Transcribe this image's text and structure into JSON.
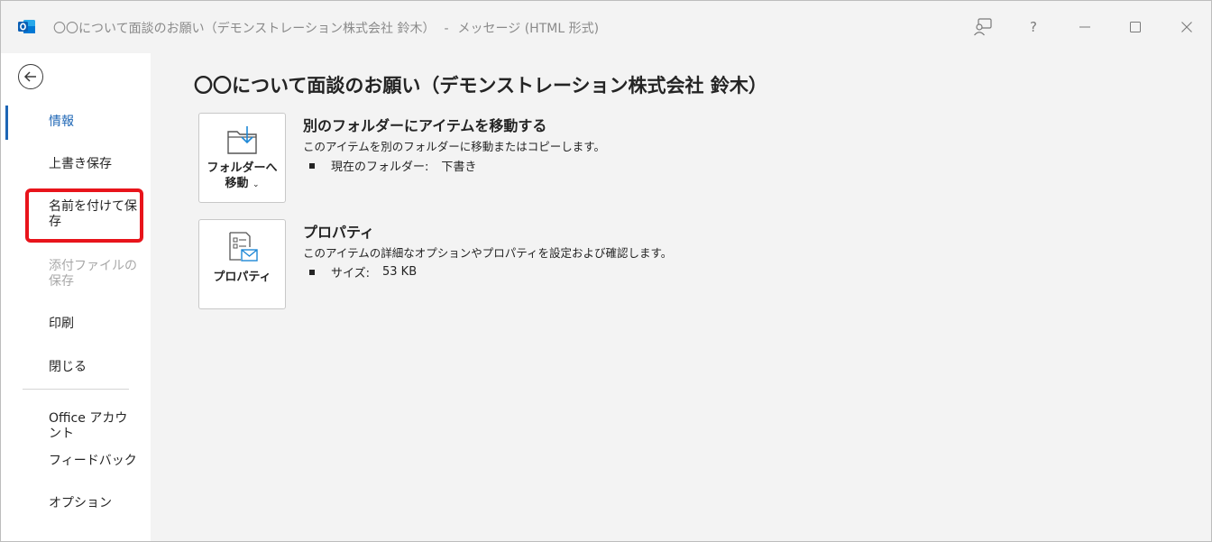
{
  "titlebar": {
    "subject": "〇〇について面談のお願い（デモンストレーション株式会社 鈴木）",
    "separator": "-",
    "window_type": "メッセージ (HTML 形式)",
    "app_icon": "outlook-icon",
    "buttons": [
      "coaching-icon",
      "help-icon",
      "minimize-icon",
      "maximize-icon",
      "close-icon"
    ],
    "help_label": "?"
  },
  "sidebar": {
    "items": [
      {
        "label": "情報",
        "state": "active"
      },
      {
        "label": "上書き保存",
        "state": "normal"
      },
      {
        "label": "名前を付けて保存",
        "state": "highlighted"
      },
      {
        "label": "添付ファイルの保存",
        "state": "disabled"
      },
      {
        "label": "印刷",
        "state": "normal"
      },
      {
        "label": "閉じる",
        "state": "normal"
      },
      {
        "label": "Office アカウント",
        "state": "normal"
      },
      {
        "label": "フィードバック",
        "state": "normal"
      },
      {
        "label": "オプション",
        "state": "normal"
      }
    ],
    "accent_color": "#1e66b5",
    "highlight_color": "#e8141b"
  },
  "main": {
    "title": "〇〇について面談のお願い（デモンストレーション株式会社 鈴木）",
    "move": {
      "button_label_line1": "フォルダーへ",
      "button_label_line2": "移動",
      "title": "別のフォルダーにアイテムを移動する",
      "description": "このアイテムを別のフォルダーに移動またはコピーします。",
      "bullet_key": "現在のフォルダー:",
      "bullet_value": "下書き"
    },
    "properties": {
      "button_label": "プロパティ",
      "title": "プロパティ",
      "description": "このアイテムの詳細なオプションやプロパティを設定および確認します。",
      "bullet_key": "サイズ:",
      "bullet_value": "53 KB"
    }
  }
}
